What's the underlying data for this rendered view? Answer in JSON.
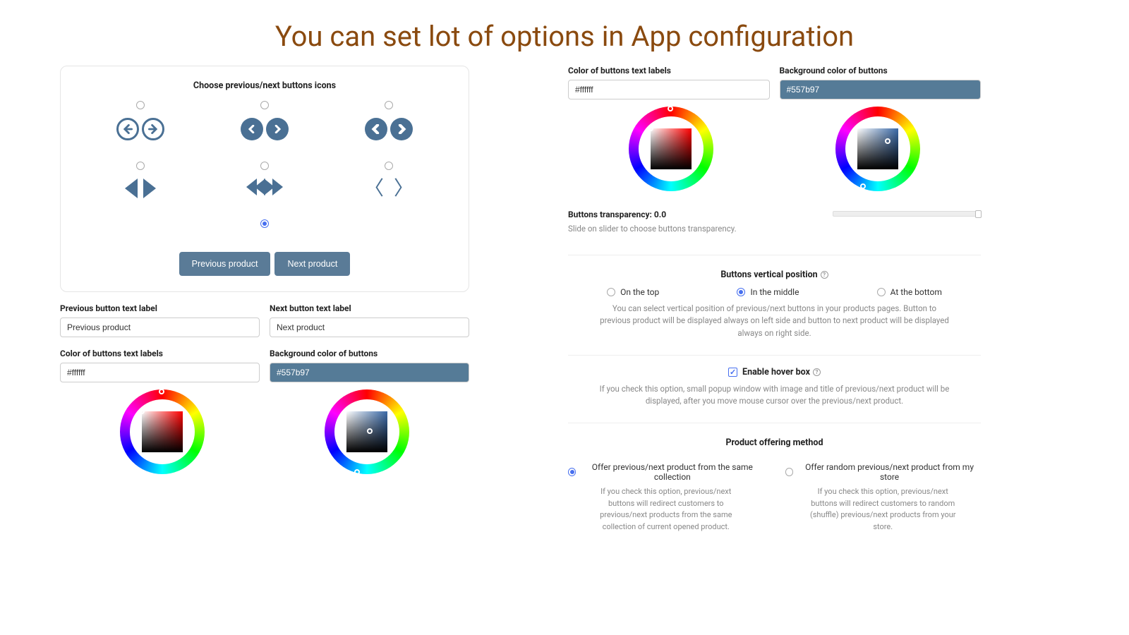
{
  "title": "You can set lot of options in App configuration",
  "left": {
    "card_title": "Choose previous/next buttons icons",
    "prev_btn": "Previous product",
    "next_btn": "Next product",
    "prev_label_field": "Previous button text label",
    "prev_value": "Previous product",
    "next_label_field": "Next button text label",
    "next_value": "Next product",
    "color_label": "Color of buttons text labels",
    "color_value": "#ffffff",
    "bg_label": "Background color of buttons",
    "bg_value": "#557b97"
  },
  "right": {
    "color_label": "Color of buttons text labels",
    "color_value": "#ffffff",
    "bg_label": "Background color of buttons",
    "bg_value": "#557b97",
    "trans_label": "Buttons transparency: 0.0",
    "trans_sub": "Slide on slider to choose buttons transparency.",
    "pos_title": "Buttons vertical position",
    "pos_top": "On the top",
    "pos_mid": "In the middle",
    "pos_bot": "At the bottom",
    "pos_help": "You can select vertical position of previous/next buttons in your products pages. Button to previous product will be displayed always on left side and button to next product will be displayed always on right side.",
    "hover_label": "Enable hover box",
    "hover_help": "If you check this option, small popup window with image and title of previous/next product will be displayed, after you move mouse cursor over the previous/next product.",
    "method_title": "Product offering method",
    "method_a": "Offer previous/next product from the same collection",
    "method_a_help": "If you check this option, previous/next buttons will redirect customers to previous/next products from the same collection of current opened product.",
    "method_b": "Offer random previous/next product from my store",
    "method_b_help": "If you check this option, previous/next buttons will redirect customers to random (shuffle) previous/next products from your store."
  }
}
